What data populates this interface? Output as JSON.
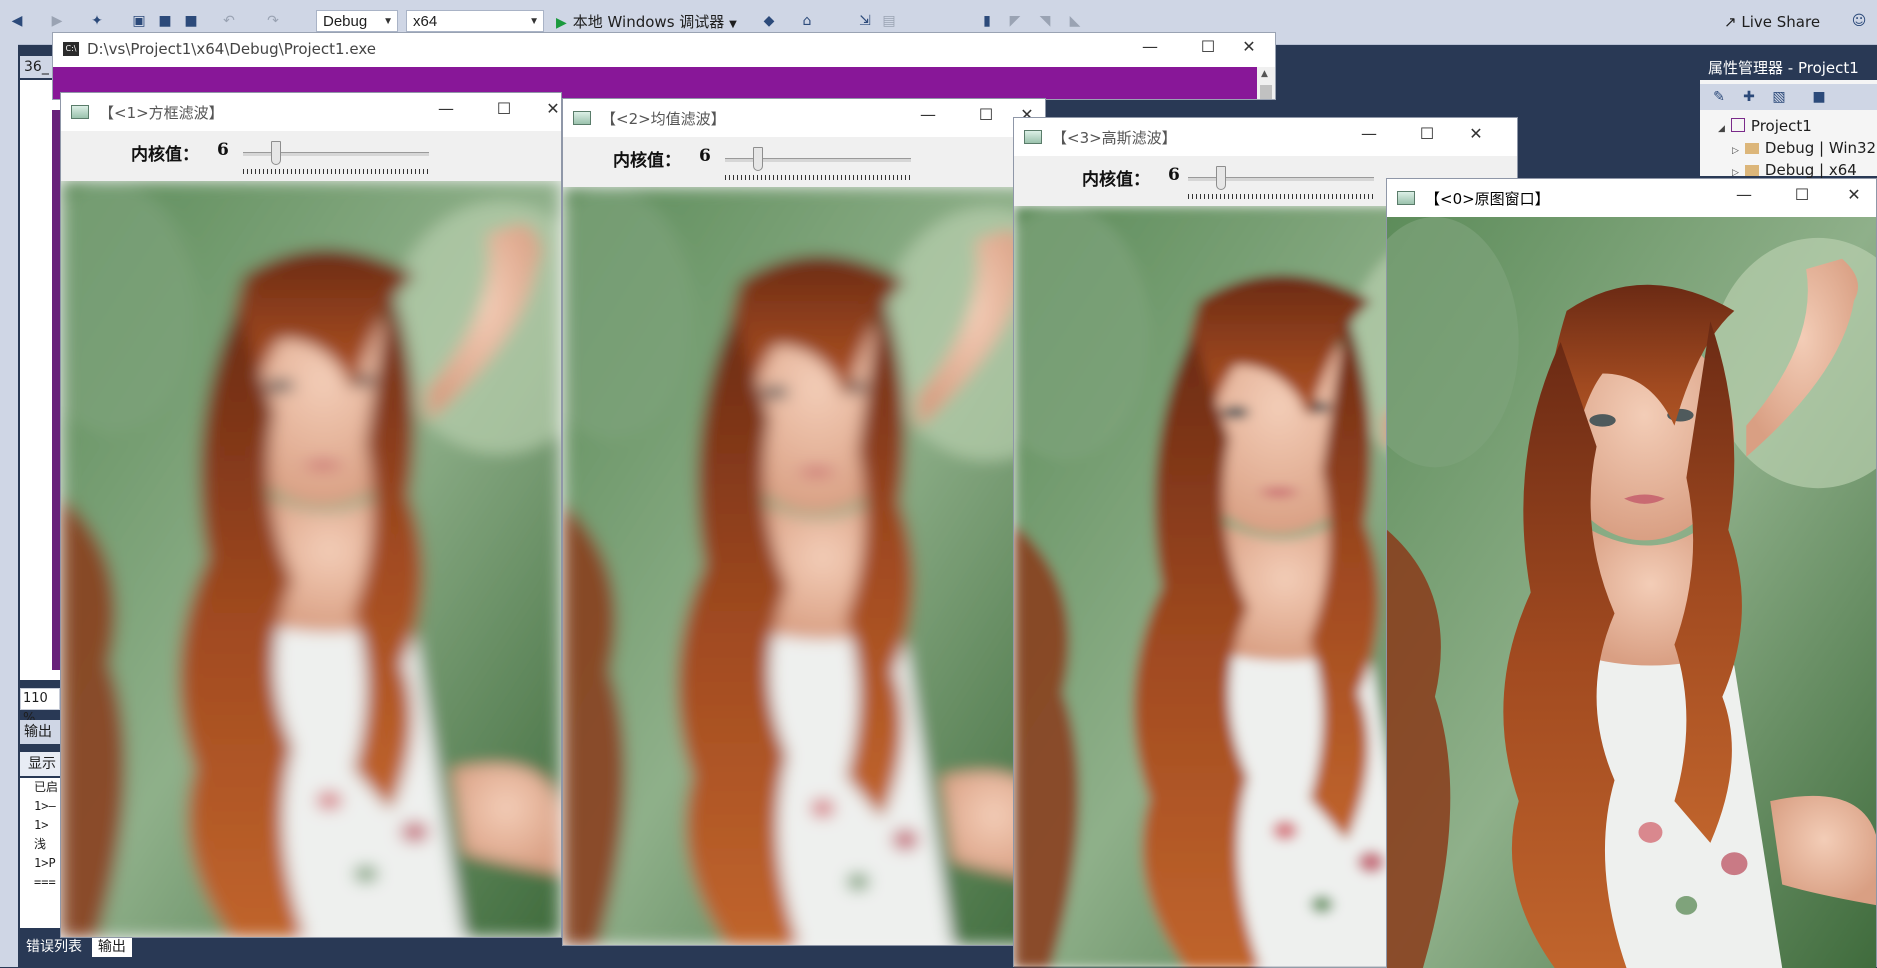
{
  "vs": {
    "config_combo": "Debug",
    "platform_combo": "x64",
    "run_button": "本地 Windows 调试器",
    "live_share": "Live Share",
    "doc_tab": "36_",
    "zoom": "110 %",
    "output_header": "输出",
    "output_show": "显示",
    "output_lines": [
      "已启",
      "1>—",
      "1>浅",
      "1>P",
      "==="
    ],
    "bottom_tabs": [
      "错误列表",
      "输出"
    ],
    "property_manager_title": "属性管理器 - Project1",
    "property_tree": [
      "Project1",
      "Debug | Win32",
      "Debug | x64"
    ]
  },
  "console": {
    "title": "D:\\vs\\Project1\\x64\\Debug\\Project1.exe",
    "bg_color": "#881798"
  },
  "windows": [
    {
      "title": "【<1>方框滤波】",
      "kernel_label": "内核值：",
      "kernel_value": "6",
      "slider_fraction": 0.18,
      "blur": "box"
    },
    {
      "title": "【<2>均值滤波】",
      "kernel_label": "内核值：",
      "kernel_value": "6",
      "slider_fraction": 0.18,
      "blur": "mean"
    },
    {
      "title": "【<3>高斯滤波】",
      "kernel_label": "内核值：",
      "kernel_value": "6",
      "slider_fraction": 0.18,
      "blur": "gaussian"
    },
    {
      "title": "【<0>原图窗口】",
      "blur": "none"
    }
  ],
  "colors": {
    "vs_dark": "#293955",
    "vs_toolbar": "#cfd6e5",
    "purple": "#881798"
  }
}
